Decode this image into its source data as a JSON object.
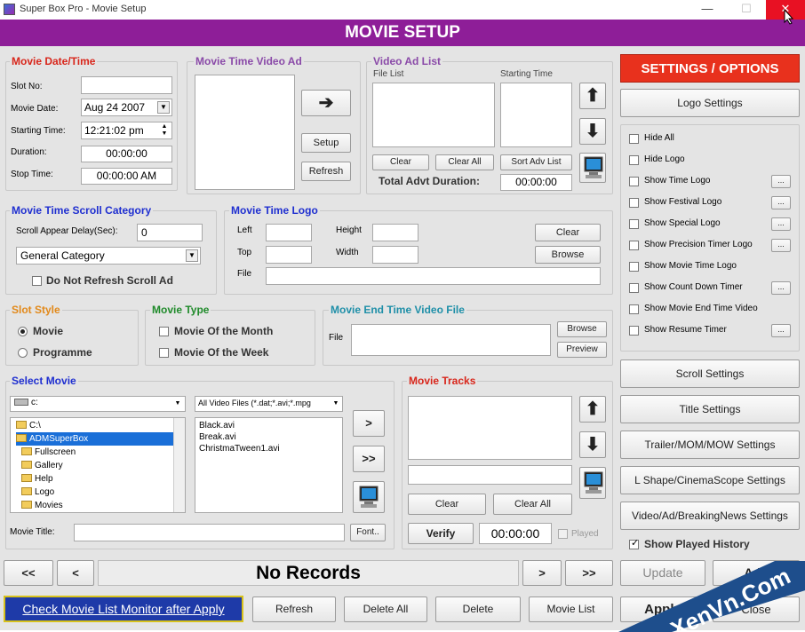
{
  "window": {
    "title": "Super Box Pro - Movie Setup",
    "minimize": "—",
    "maximize": "☐",
    "close": "✕"
  },
  "header": {
    "title": "MOVIE SETUP"
  },
  "datetime": {
    "legend": "Movie Date/Time",
    "slot_no_label": "Slot No:",
    "slot_no_value": "",
    "movie_date_label": "Movie Date:",
    "movie_date_value": "Aug 24 2007",
    "starting_time_label": "Starting Time:",
    "starting_time_value": "12:21:02 pm",
    "duration_label": "Duration:",
    "duration_value": "00:00:00",
    "stop_time_label": "Stop Time:",
    "stop_time_value": "00:00:00 AM"
  },
  "time_video_ad": {
    "legend": "Movie Time Video Ad",
    "arrow": "➔",
    "setup": "Setup",
    "refresh": "Refresh"
  },
  "video_ad_list": {
    "legend": "Video Ad List",
    "file_list_label": "File List",
    "starting_time_label": "Starting Time",
    "up": "⬆",
    "down": "⬇",
    "clear": "Clear",
    "clear_all": "Clear All",
    "sort": "Sort Adv List",
    "total_label": "Total Advt Duration:",
    "total_value": "00:00:00"
  },
  "scroll_category": {
    "legend": "Movie Time Scroll Category",
    "delay_label": "Scroll Appear Delay(Sec):",
    "delay_value": "0",
    "category": "General Category",
    "no_refresh": "Do Not Refresh Scroll Ad"
  },
  "time_logo": {
    "legend": "Movie Time Logo",
    "left": "Left",
    "top": "Top",
    "height": "Height",
    "width": "Width",
    "file": "File",
    "clear": "Clear",
    "browse": "Browse"
  },
  "slot_style": {
    "legend": "Slot Style",
    "movie": "Movie",
    "programme": "Programme"
  },
  "movie_type": {
    "legend": "Movie Type",
    "month": "Movie Of the Month",
    "week": "Movie Of the Week"
  },
  "end_video": {
    "legend": "Movie End Time Video File",
    "file": "File",
    "browse": "Browse",
    "preview": "Preview"
  },
  "select_movie": {
    "legend": "Select Movie",
    "drive": "c:",
    "filter": "All Video Files (*.dat;*.avi;*.mpg",
    "tree": [
      "C:\\",
      "ADMSuperBox",
      "Fullscreen",
      "Gallery",
      "Help",
      "Logo",
      "Movies"
    ],
    "files": [
      "Black.avi",
      "Break.avi",
      "ChristmaTween1.avi"
    ],
    "add_one": ">",
    "add_all": ">>",
    "movie_title_label": "Movie Title:",
    "movie_title_value": "",
    "font": "Font.."
  },
  "tracks": {
    "legend": "Movie Tracks",
    "up": "⬆",
    "down": "⬇",
    "clear": "Clear",
    "clear_all": "Clear All",
    "verify": "Verify",
    "time": "00:00:00",
    "played": "Played"
  },
  "nav": {
    "first": "<<",
    "prev": "<",
    "status": "No Records",
    "next": ">",
    "last": ">>",
    "update": "Update",
    "add": "Add"
  },
  "bottom": {
    "monitor_link": "Check Movie List Monitor after Apply",
    "refresh": "Refresh",
    "delete_all": "Delete All",
    "delete": "Delete",
    "movie_list": "Movie List",
    "apply": "Apply",
    "close": "Close"
  },
  "settings": {
    "title": "SETTINGS / OPTIONS",
    "logo_settings": "Logo Settings",
    "options": [
      {
        "label": "Hide All",
        "dots": false
      },
      {
        "label": "Hide Logo",
        "dots": false
      },
      {
        "label": "Show Time Logo",
        "dots": true
      },
      {
        "label": "Show Festival Logo",
        "dots": true
      },
      {
        "label": "Show Special Logo",
        "dots": true
      },
      {
        "label": "Show Precision Timer Logo",
        "dots": true
      },
      {
        "label": "Show Movie Time Logo",
        "dots": false
      },
      {
        "label": "Show Count Down Timer",
        "dots": true
      },
      {
        "label": "Show Movie End Time Video",
        "dots": false
      },
      {
        "label": "Show Resume Timer",
        "dots": true
      }
    ],
    "dots": "...",
    "scroll": "Scroll Settings",
    "title_settings": "Title Settings",
    "trailer": "Trailer/MOM/MOW Settings",
    "lshape": "L Shape/CinemaScope Settings",
    "video_ad": "Video/Ad/BreakingNews Settings",
    "show_played": "Show Played History"
  },
  "watermark": "XenVn.Com",
  "colors": {
    "header_bg": "#8e1e98",
    "settings_title_bg": "#e8311d",
    "window_bg": "#e4e4e4",
    "selection": "#1a6fd8",
    "watermark_bg": "#1e4e8c"
  }
}
